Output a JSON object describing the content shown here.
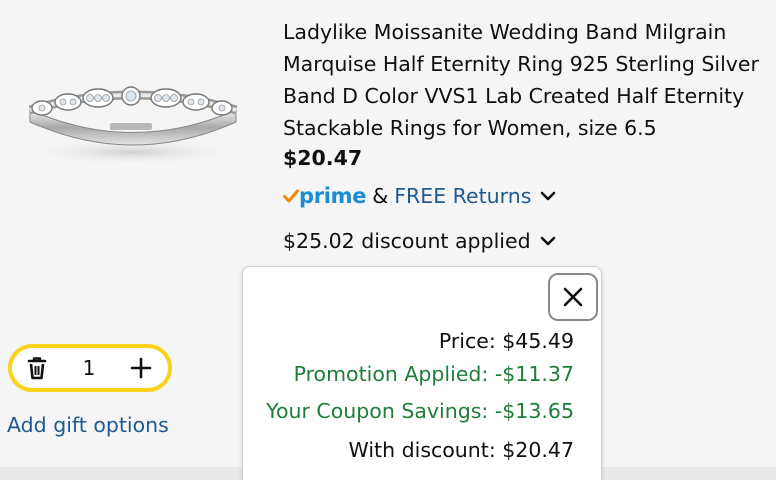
{
  "product": {
    "title": "Ladylike Moissanite Wedding Band Milgrain Marquise Half Eternity Ring 925 Sterling Silver Band D Color VVS1 Lab Created Half Eternity Stackable Rings for Women, size 6.5",
    "price": "$20.47",
    "image_alt": "ring-photo"
  },
  "shipping": {
    "prime_label": "prime",
    "amp": "&",
    "free_returns": "FREE Returns"
  },
  "discount": {
    "label": "$25.02 discount applied"
  },
  "popover": {
    "price_line": "Price: $45.49",
    "promotion_line": "Promotion Applied: -$11.37",
    "coupon_line": "Your Coupon Savings: -$13.65",
    "with_discount_line": "With discount: $20.47"
  },
  "cart": {
    "quantity": "1"
  },
  "gift": {
    "label": "Add gift options"
  },
  "colors": {
    "link": "#1f5a92",
    "prime_blue": "#1a8cd8",
    "prime_check": "#f08804",
    "savings_green": "#1f7d3a",
    "stepper_border": "#f8d21c"
  }
}
